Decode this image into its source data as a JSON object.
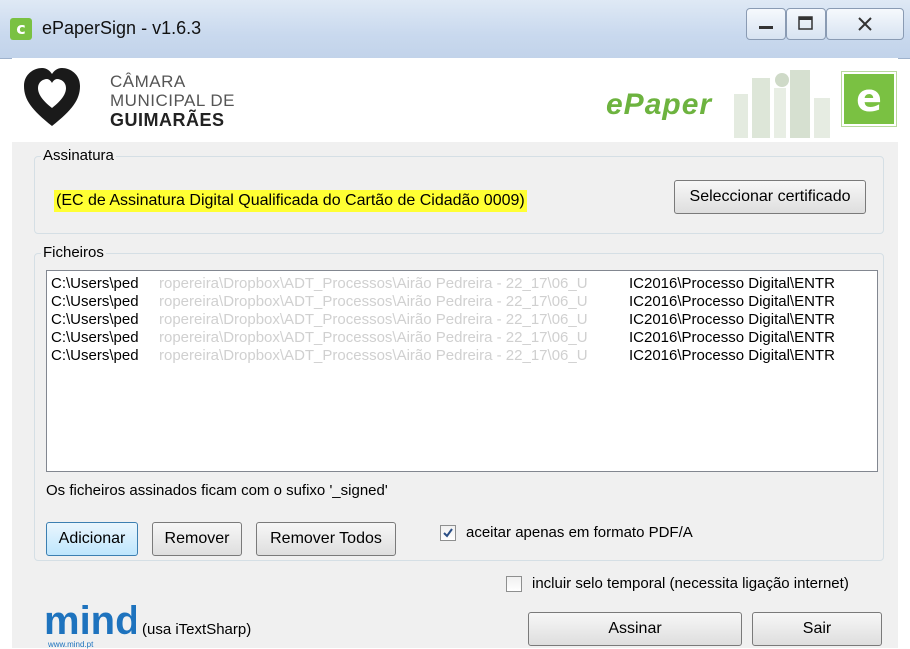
{
  "window": {
    "title": "ePaperSign - v1.6.3",
    "app_icon_glyph": "c",
    "controls": [
      "minimize-icon",
      "maximize-icon",
      "close-icon"
    ]
  },
  "header": {
    "org_line1": "CÂMARA",
    "org_line2": "MUNICIPAL DE",
    "org_line3": "GUIMARÃES",
    "brand": "ePaper",
    "brand_badge": "e",
    "brand_color": "#7ac142"
  },
  "assinatura": {
    "group_label": "Assinatura",
    "certificate": "(EC de Assinatura Digital Qualificada do Cartão de Cidadão 0009)",
    "highlight_color": "#ffff33",
    "select_button": "Seleccionar certificado"
  },
  "ficheiros": {
    "group_label": "Ficheiros",
    "files": [
      {
        "start": "C:\\Users\\ped",
        "middle": "ropereira\\Dropbox\\ADT_Processos\\Airão Pedreira - 22_17\\06_U",
        "end": "IC2016\\Processo Digital\\ENTR"
      },
      {
        "start": "C:\\Users\\ped",
        "middle": "ropereira\\Dropbox\\ADT_Processos\\Airão Pedreira - 22_17\\06_U",
        "end": "IC2016\\Processo Digital\\ENTR"
      },
      {
        "start": "C:\\Users\\ped",
        "middle": "ropereira\\Dropbox\\ADT_Processos\\Airão Pedreira - 22_17\\06_U",
        "end": "IC2016\\Processo Digital\\ENTR"
      },
      {
        "start": "C:\\Users\\ped",
        "middle": "ropereira\\Dropbox\\ADT_Processos\\Airão Pedreira - 22_17\\06_U",
        "end": "IC2016\\Processo Digital\\ENTR"
      },
      {
        "start": "C:\\Users\\ped",
        "middle": "ropereira\\Dropbox\\ADT_Processos\\Airão Pedreira - 22_17\\06_U",
        "end": "IC2016\\Processo Digital\\ENTR"
      }
    ],
    "suffix_note": "Os ficheiros assinados ficam com o sufixo '_signed'",
    "add_button": "Adicionar",
    "remove_button": "Remover",
    "remove_all_button": "Remover Todos",
    "pdfa_label": "aceitar apenas em formato PDF/A",
    "pdfa_checked": true
  },
  "footer": {
    "timestamp_label": "incluir selo temporal (necessita ligação internet)",
    "timestamp_checked": false,
    "mind_logo": "mind",
    "mind_url": "www.mind.pt",
    "itext_note": "(usa iTextSharp)",
    "sign_button": "Assinar",
    "exit_button": "Sair"
  }
}
